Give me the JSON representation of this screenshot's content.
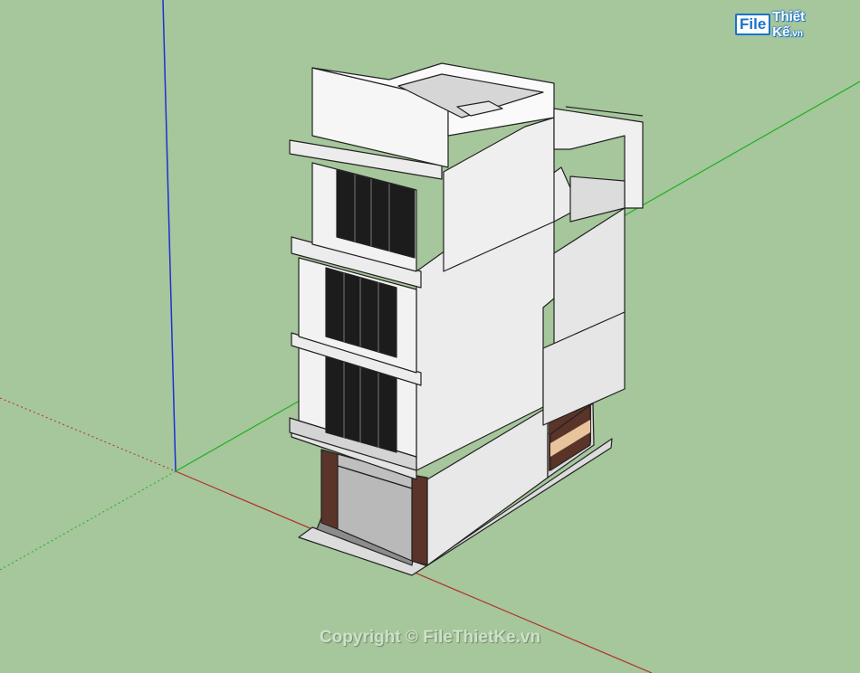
{
  "watermark": {
    "logo_file": "File",
    "logo_name": "Thiết Kế",
    "logo_ext": ".vn",
    "copyright": "Copyright © FileThietKe.vn"
  },
  "colors": {
    "ground": "#a6c69b",
    "axis_red": "#b0312c",
    "axis_green": "#1fb01f",
    "axis_blue": "#1d2fd6",
    "wall_light": "#f4f4f4",
    "wall_shade": "#e2e2e2",
    "wall_dark": "#cfcfcf",
    "window_glass": "#1c1c1c",
    "wood_panel": "#5a3428",
    "floor": "#8c8c8c"
  }
}
